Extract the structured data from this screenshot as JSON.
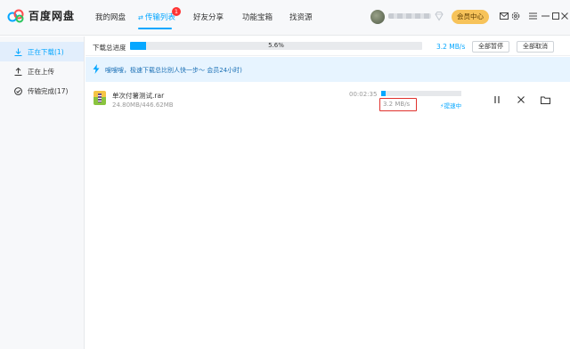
{
  "app": {
    "name": "百度网盘"
  },
  "nav": {
    "items": [
      {
        "label": "我的网盘"
      },
      {
        "label": "传输列表",
        "badge": "1"
      },
      {
        "label": "好友分享"
      },
      {
        "label": "功能宝箱"
      },
      {
        "label": "找资源"
      }
    ],
    "active": "传输列表"
  },
  "header": {
    "vip_label": "会员中心",
    "icons": [
      "mail-icon",
      "settings-icon",
      "menu-icon",
      "minimize-icon",
      "maximize-icon",
      "close-icon"
    ]
  },
  "sidebar": {
    "items": [
      {
        "label": "正在下载(1)",
        "icon": "download-icon",
        "active": true
      },
      {
        "label": "正在上传",
        "icon": "upload-icon",
        "active": false
      },
      {
        "label": "传输完成(17)",
        "icon": "check-circle-icon",
        "active": false
      }
    ]
  },
  "overall": {
    "label": "下载总进度",
    "percent_text": "5.6%",
    "progress": 0.056,
    "speed": "3.2 MB/s",
    "pause_all": "全部暂停",
    "cancel_all": "全部取消"
  },
  "banner": {
    "text": "嗖嗖嗖，极速下载总比别人快一步～ 会员24小时)"
  },
  "task": {
    "name": "单次付薯测试.rar",
    "size": "24.80MB/446.62MB",
    "time": "00:02:35",
    "progress": 0.056,
    "speed": "3.2 MB/s",
    "boost_label": "提速中"
  },
  "colors": {
    "accent": "#06a7ff",
    "highlight_box": "#e0312d",
    "vip": "#f7c35a"
  }
}
